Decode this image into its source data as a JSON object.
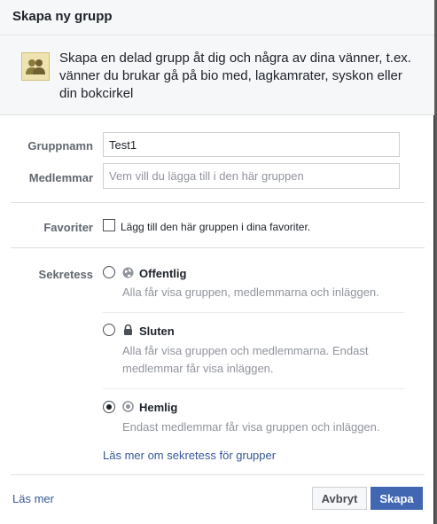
{
  "dialog": {
    "title": "Skapa ny grupp",
    "intro": "Skapa en delad grupp åt dig och några av dina vänner, t.ex. vänner du brukar gå på bio med, lagkamrater, syskon eller din bokcirkel"
  },
  "form": {
    "group_name_label": "Gruppnamn",
    "group_name_value": "Test1",
    "members_label": "Medlemmar",
    "members_placeholder": "Vem vill du lägga till i den här gruppen",
    "favorites_label": "Favoriter",
    "favorites_checkbox_label": "Lägg till den här gruppen i dina favoriter.",
    "favorites_checked": false,
    "privacy_label": "Sekretess"
  },
  "privacy_options": [
    {
      "title": "Offentlig",
      "description": "Alla får visa gruppen, medlemmarna och inläggen.",
      "icon": "globe-icon",
      "selected": false
    },
    {
      "title": "Sluten",
      "description": "Alla får visa gruppen och medlemmarna. Endast medlemmar får visa inläggen.",
      "icon": "lock-icon",
      "selected": false
    },
    {
      "title": "Hemlig",
      "description": "Endast medlemmar får visa gruppen och inläggen.",
      "icon": "secret-icon",
      "selected": true
    }
  ],
  "privacy_learn_more": "Läs mer om sekretess för grupper",
  "footer": {
    "learn_more": "Läs mer",
    "cancel": "Avbryt",
    "create": "Skapa"
  },
  "colors": {
    "primary_button": "#4267b2",
    "link": "#365899",
    "muted_text": "#90949c"
  }
}
